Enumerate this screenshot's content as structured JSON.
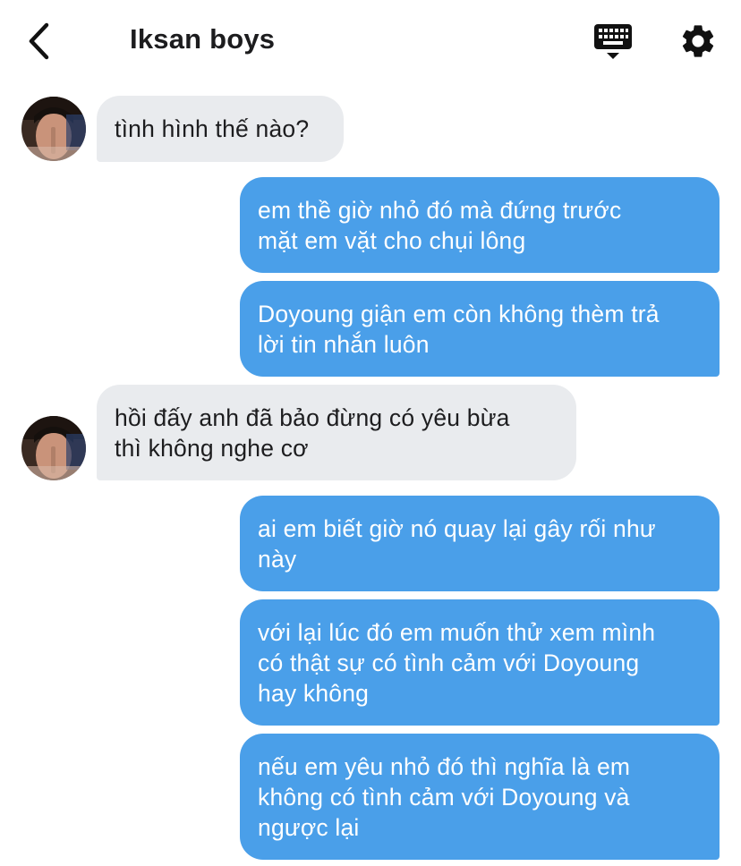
{
  "header": {
    "title": "Iksan boys"
  },
  "icons": {
    "back": "chevron-left-icon",
    "keyboard": "keyboard-icon",
    "settings": "gear-icon"
  },
  "colors": {
    "incoming_bubble": "#e9ebee",
    "outgoing_bubble": "#4a9fe9"
  },
  "messages": [
    {
      "direction": "incoming",
      "text": "tình hình thế nào?"
    },
    {
      "direction": "outgoing",
      "text": "em thề giờ nhỏ đó mà đứng trước\nmặt em vặt cho chụi lông"
    },
    {
      "direction": "outgoing",
      "text": "Doyoung giận em còn không thèm trả\nlời tin nhắn luôn"
    },
    {
      "direction": "incoming",
      "text": "hồi đấy anh đã bảo đừng có yêu bừa\nthì không nghe cơ"
    },
    {
      "direction": "outgoing",
      "text": "ai em biết giờ nó quay lại gây rối như\nnày"
    },
    {
      "direction": "outgoing",
      "text": "với lại lúc đó em muốn thử xem mình\ncó thật sự có tình cảm với Doyoung\nhay không"
    },
    {
      "direction": "outgoing",
      "text": "nếu em yêu nhỏ đó thì nghĩa là em\nkhông có tình cảm với Doyoung và\nngược lại"
    }
  ]
}
